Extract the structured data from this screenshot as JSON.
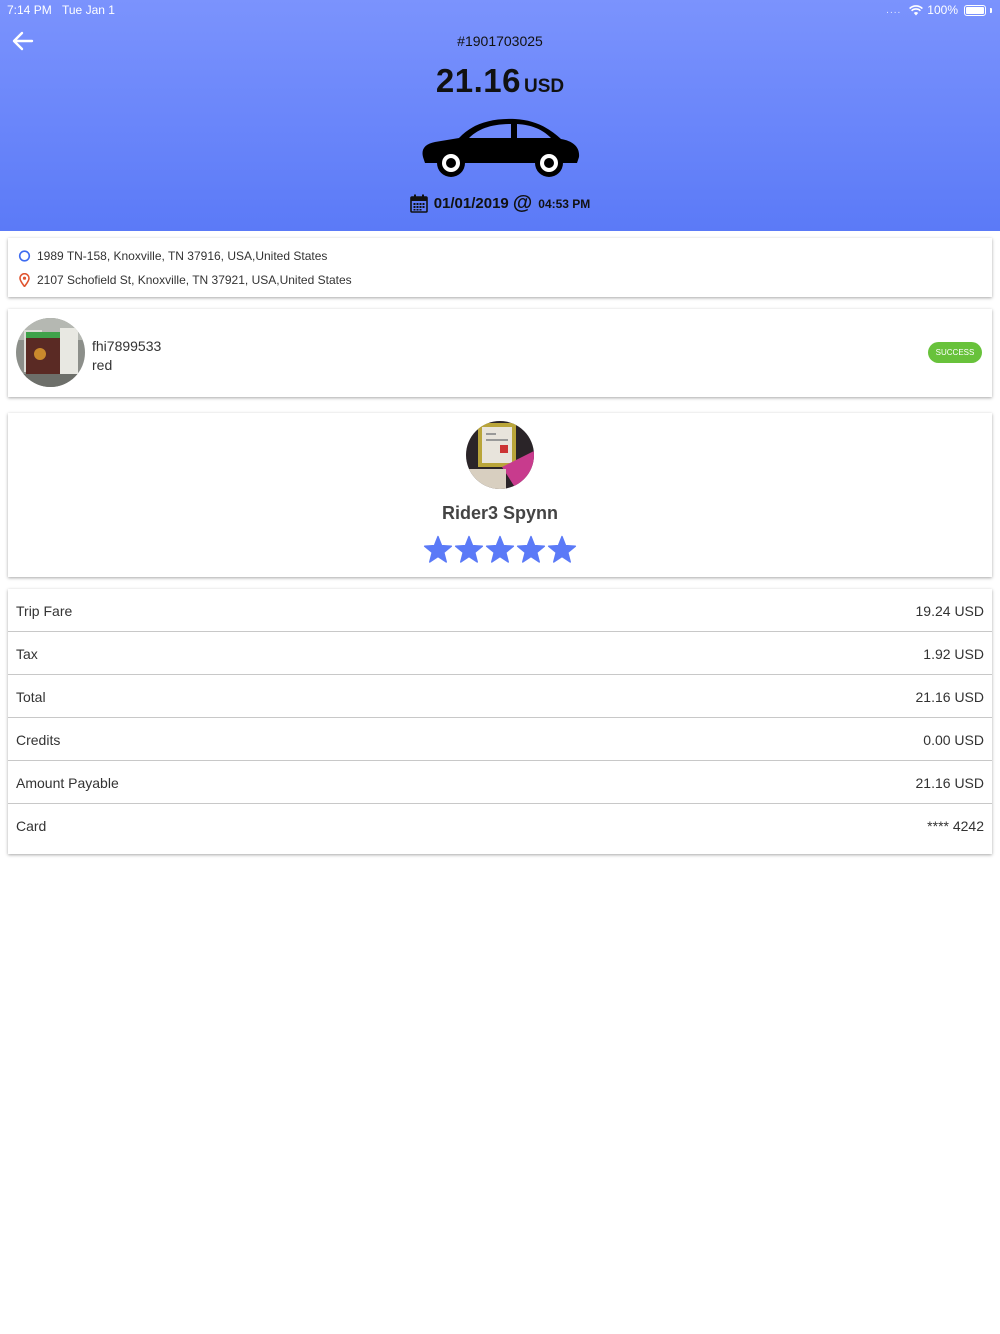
{
  "status_bar": {
    "time": "7:14 PM",
    "date": "Tue Jan 1",
    "battery": "100%"
  },
  "trip": {
    "id": "#1901703025",
    "amount": "21.16",
    "currency": "USD",
    "date": "01/01/2019",
    "at": "@",
    "time": "04:53 PM"
  },
  "addresses": {
    "pickup": "1989 TN-158, Knoxville, TN 37916, USA,United States",
    "dropoff": "2107 Schofield St, Knoxville, TN 37921, USA,United States"
  },
  "driver": {
    "name": "fhi7899533",
    "car": "red",
    "status": "SUCCESS"
  },
  "rider": {
    "name": "Rider3 Spynn",
    "rating": 5,
    "max_rating": 5
  },
  "fare_breakdown": [
    {
      "label": "Trip Fare",
      "value": "19.24 USD"
    },
    {
      "label": "Tax",
      "value": "1.92 USD"
    },
    {
      "label": "Total",
      "value": "21.16 USD"
    },
    {
      "label": "Credits",
      "value": "0.00 USD"
    },
    {
      "label": "Amount Payable",
      "value": "21.16 USD"
    },
    {
      "label": "Card",
      "value": "**** 4242"
    }
  ],
  "colors": {
    "header_top": "#7b93fd",
    "header_bottom": "#5b7af7",
    "star": "#5b7af7",
    "success": "#68c23b",
    "pickup": "#3d6bf0",
    "dropoff": "#e05530"
  }
}
